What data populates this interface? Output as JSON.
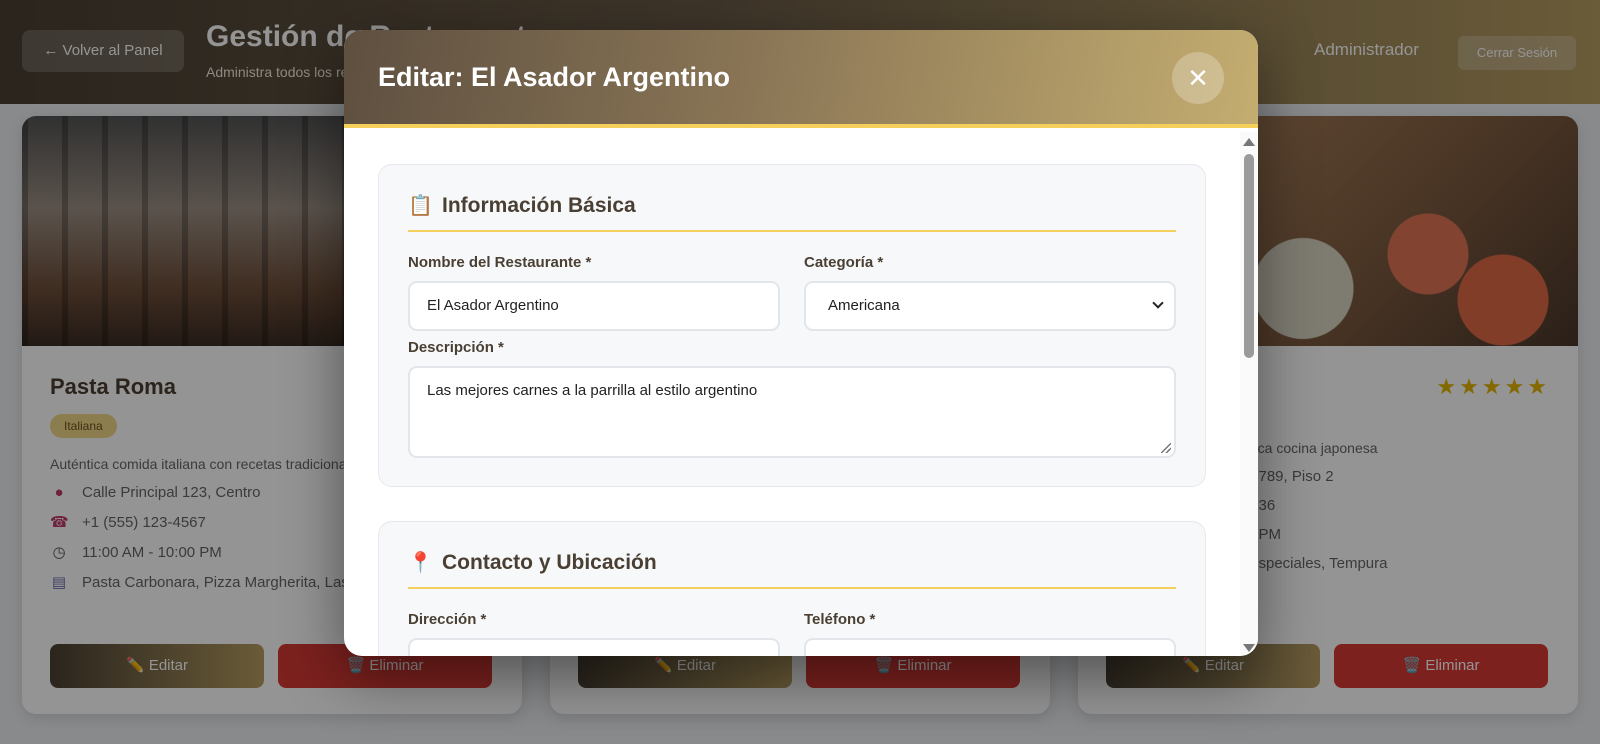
{
  "page": {
    "back_button": "← Volver al Panel",
    "title": "Gestión de Restaurantes",
    "subtitle": "Administra todos los restaurantes",
    "user": "Administrador",
    "logout": "Cerrar Sesión"
  },
  "cards": [
    {
      "name": "Pasta Roma",
      "category": "Italiana",
      "description": "Auténtica comida italiana con recetas tradicionales",
      "address": "Calle Principal 123, Centro",
      "phone": "+1 (555) 123-4567",
      "hours": "11:00 AM - 10:00 PM",
      "dishes": "Pasta Carbonara, Pizza Margherita, Lasagna",
      "edit": "✏️ Editar",
      "delete": "🗑️ Eliminar"
    },
    {
      "edit": "✏️ Editar",
      "delete": "🗑️ Eliminar"
    },
    {
      "description": "...ca cocina japonesa",
      "address": "...789, Piso 2",
      "phone": "...36",
      "hours": "...PM",
      "dishes": "...speciales, Tempura",
      "stars": "★★★★★",
      "edit": "✏️ Editar",
      "delete": "🗑️ Eliminar"
    }
  ],
  "modal": {
    "title": "Editar: El Asador Argentino",
    "close_label": "✕",
    "sections": {
      "basic": {
        "icon": "📋",
        "title": "Información Básica",
        "name_label": "Nombre del Restaurante *",
        "name_value": "El Asador Argentino",
        "category_label": "Categoría *",
        "category_value": "Americana",
        "description_label": "Descripción *",
        "description_value": "Las mejores carnes a la parrilla al estilo argentino"
      },
      "contact": {
        "icon": "📍",
        "title": "Contacto y Ubicación",
        "address_label": "Dirección *",
        "phone_label": "Teléfono *"
      }
    }
  },
  "colors": {
    "header_gradient_start": "#5e4f40",
    "header_gradient_end": "#c4ad70",
    "accent": "#f4cf5c",
    "delete": "#d63a34"
  }
}
